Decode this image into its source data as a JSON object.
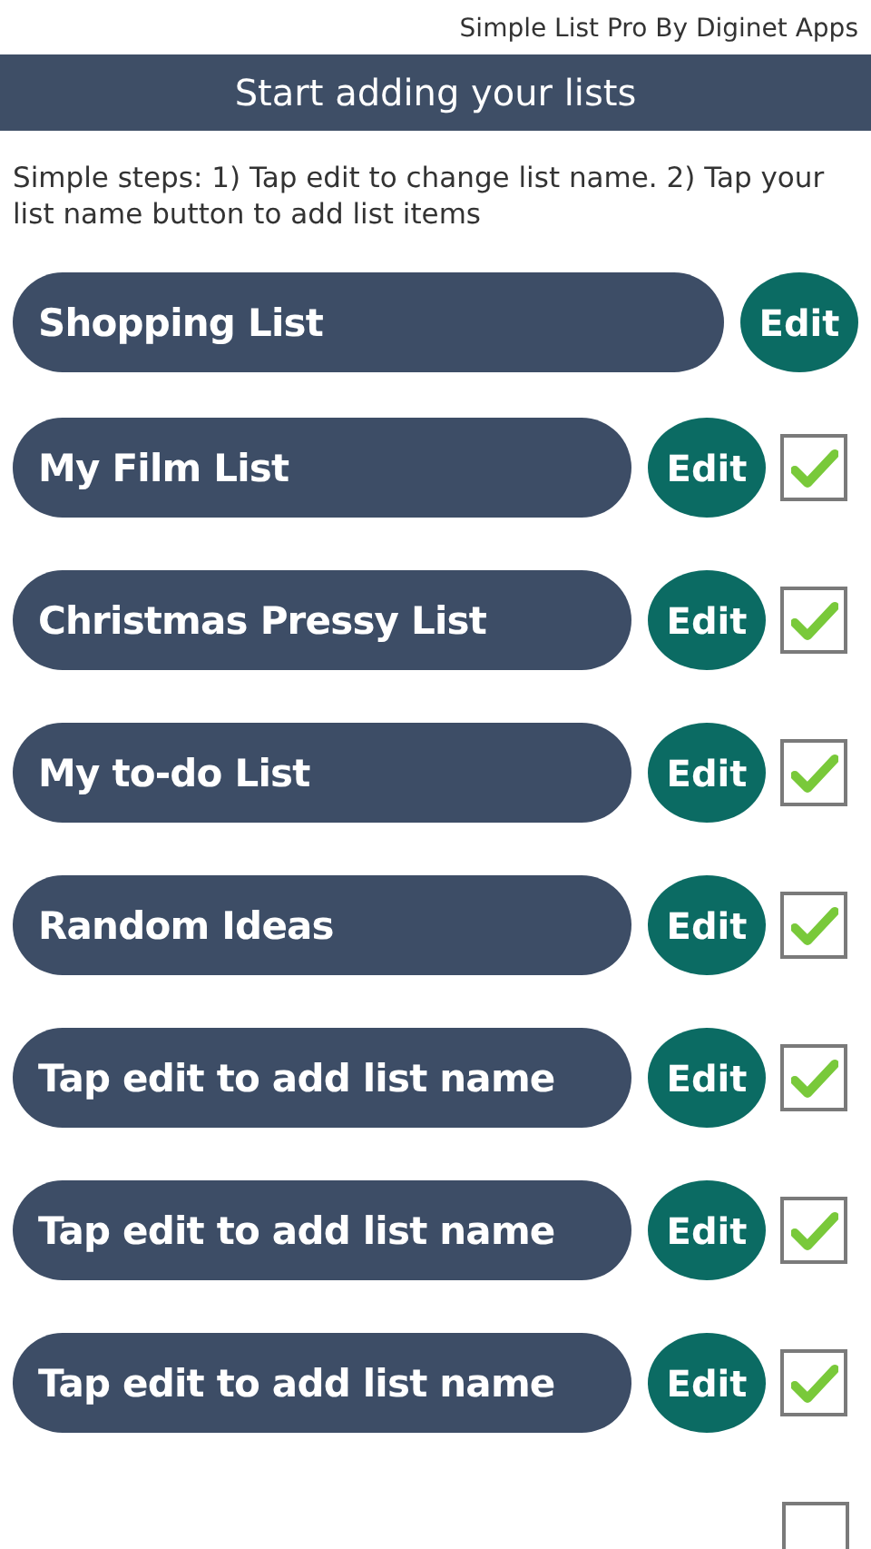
{
  "app_credit": "Simple List Pro By Diginet Apps",
  "title_bar": {
    "title": "Start adding your lists"
  },
  "instructions": "Simple steps: 1) Tap edit to change list name. 2) Tap your list name button to add list items",
  "lists": [
    {
      "kind": "plain",
      "name": "Shopping List",
      "edit_label": "Edit"
    },
    {
      "kind": "checkable",
      "name": "My Film List",
      "edit_label": "Edit",
      "checked": true
    },
    {
      "kind": "checkable",
      "name": "Christmas Pressy List",
      "edit_label": "Edit",
      "checked": true
    },
    {
      "kind": "checkable",
      "name": "My to-do List",
      "edit_label": "Edit",
      "checked": true
    },
    {
      "kind": "checkable",
      "name": "Random Ideas",
      "edit_label": "Edit",
      "checked": true
    },
    {
      "kind": "checkable",
      "name": "Tap edit to add list name",
      "edit_label": "Edit",
      "checked": true
    },
    {
      "kind": "checkable",
      "name": "Tap edit to add list name",
      "edit_label": "Edit",
      "checked": true
    },
    {
      "kind": "checkable",
      "name": "Tap edit to add list name",
      "edit_label": "Edit",
      "checked": true
    },
    {
      "kind": "checkbox_only",
      "checked": false
    }
  ]
}
